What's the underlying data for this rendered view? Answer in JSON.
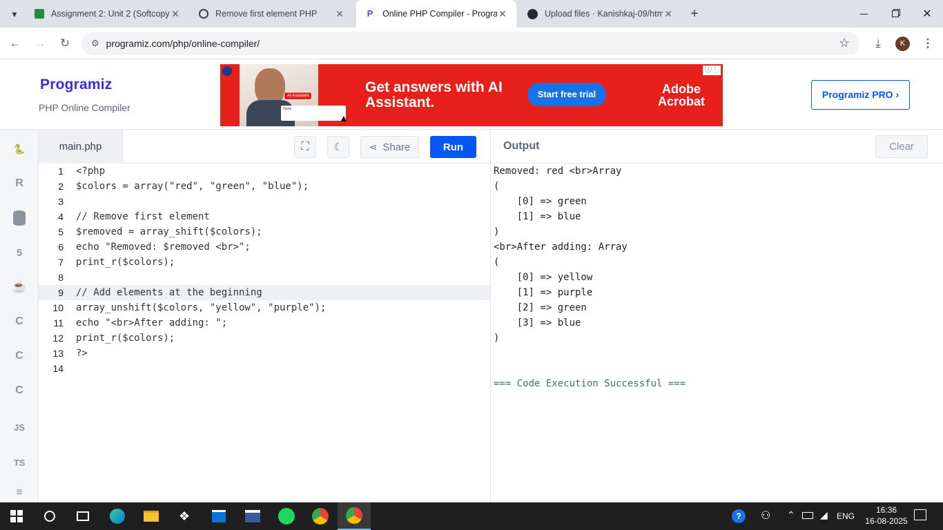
{
  "browser": {
    "tabs": [
      {
        "label": "Assignment 2: Unit 2 (Softcopy"
      },
      {
        "label": "Remove first element PHP"
      },
      {
        "label": "Online PHP Compiler - Program"
      },
      {
        "label": "Upload files · Kanishkaj-09/htm"
      }
    ],
    "new_tab": "+",
    "url": "programiz.com/php/online-compiler/",
    "profile_initial": "K"
  },
  "site": {
    "logo": "Programiz",
    "subtitle": "PHP Online Compiler",
    "pro_button": "Programiz PRO ›",
    "ad": {
      "headline": "Get answers with AI Assistant.",
      "cta": "Start free trial",
      "brand_line1": "Adobe",
      "brand_line2": "Acrobat",
      "chip": "AI Assistant",
      "input_text": "Gene"
    }
  },
  "sidebar": {
    "items": [
      "python",
      "r",
      "sql",
      "html",
      "java",
      "c",
      "cpp",
      "csharp",
      "JS",
      "TS",
      "swift"
    ]
  },
  "editor": {
    "filename": "main.php",
    "share_label": "Share",
    "run_label": "Run",
    "highlighted_line": 9,
    "lines": [
      {
        "n": "1",
        "t": "<?php"
      },
      {
        "n": "2",
        "t": "$colors = array(\"red\", \"green\", \"blue\");"
      },
      {
        "n": "3",
        "t": ""
      },
      {
        "n": "4",
        "t": "// Remove first element"
      },
      {
        "n": "5",
        "t": "$removed = array_shift($colors);"
      },
      {
        "n": "6",
        "t": "echo \"Removed: $removed <br>\";"
      },
      {
        "n": "7",
        "t": "print_r($colors);"
      },
      {
        "n": "8",
        "t": ""
      },
      {
        "n": "9",
        "t": "// Add elements at the beginning"
      },
      {
        "n": "10",
        "t": "array_unshift($colors, \"yellow\", \"purple\");"
      },
      {
        "n": "11",
        "t": "echo \"<br>After adding: \";"
      },
      {
        "n": "12",
        "t": "print_r($colors);"
      },
      {
        "n": "13",
        "t": "?>"
      },
      {
        "n": "14",
        "t": ""
      }
    ]
  },
  "output": {
    "title": "Output",
    "clear_label": "Clear",
    "lines": [
      "Removed: red <br>Array",
      "(",
      "    [0] => green",
      "    [1] => blue",
      ")",
      "<br>After adding: Array",
      "(",
      "    [0] => yellow",
      "    [1] => purple",
      "    [2] => green",
      "    [3] => blue",
      ")",
      "",
      "",
      "=== Code Execution Successful ==="
    ]
  },
  "taskbar": {
    "lang": "ENG",
    "time": "16:36",
    "date": "16-08-2025"
  },
  "colors": {
    "run_blue": "#0556f3",
    "ad_red": "#e8201b",
    "success_green": "#3b7a57"
  }
}
